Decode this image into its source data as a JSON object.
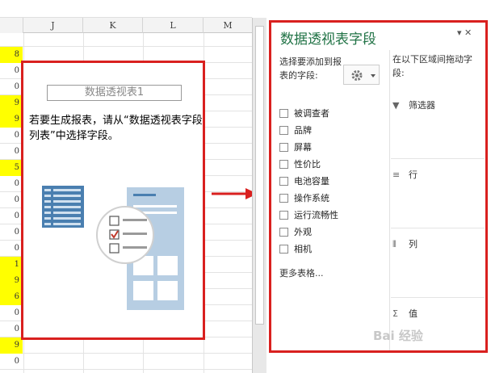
{
  "sheet": {
    "columns": [
      "J",
      "K",
      "L",
      "M"
    ],
    "values": [
      {
        "v": "8",
        "hl": true
      },
      {
        "v": "0",
        "hl": false
      },
      {
        "v": "0",
        "hl": false
      },
      {
        "v": "9",
        "hl": true
      },
      {
        "v": "9",
        "hl": true
      },
      {
        "v": "0",
        "hl": false
      },
      {
        "v": "0",
        "hl": false
      },
      {
        "v": "5",
        "hl": true
      },
      {
        "v": "0",
        "hl": false
      },
      {
        "v": "0",
        "hl": false
      },
      {
        "v": "0",
        "hl": false
      },
      {
        "v": "0",
        "hl": false
      },
      {
        "v": "0",
        "hl": false
      },
      {
        "v": "1",
        "hl": true
      },
      {
        "v": "9",
        "hl": true
      },
      {
        "v": "6",
        "hl": true
      },
      {
        "v": "0",
        "hl": false
      },
      {
        "v": "0",
        "hl": false
      },
      {
        "v": "9",
        "hl": true
      },
      {
        "v": "0",
        "hl": false
      }
    ]
  },
  "placeholder": {
    "title": "数据透视表1",
    "message": "若要生成报表，请从“数据透视表字段列表”中选择字段。"
  },
  "pane": {
    "title": "数据透视表字段",
    "controls": "▾ ✕",
    "choose_label": "选择要添加到报表的字段:",
    "drag_label": "在以下区域间拖动字段:",
    "fields": [
      "被调查者",
      "品牌",
      "屏幕",
      "性价比",
      "电池容量",
      "操作系统",
      "运行流畅性",
      "外观",
      "相机"
    ],
    "more_tables": "更多表格...",
    "areas": [
      {
        "label": "筛选器",
        "icon": "filter-icon",
        "glyph": "▼"
      },
      {
        "label": "行",
        "icon": "rows-icon",
        "glyph": "≡"
      },
      {
        "label": "列",
        "icon": "columns-icon",
        "glyph": "⦀"
      },
      {
        "label": "值",
        "icon": "sum-icon",
        "glyph": "Σ"
      }
    ]
  },
  "watermark": "Bai 经验",
  "colors": {
    "accent": "#217346",
    "highlight": "#ffff00",
    "annotation": "#d9201f"
  }
}
